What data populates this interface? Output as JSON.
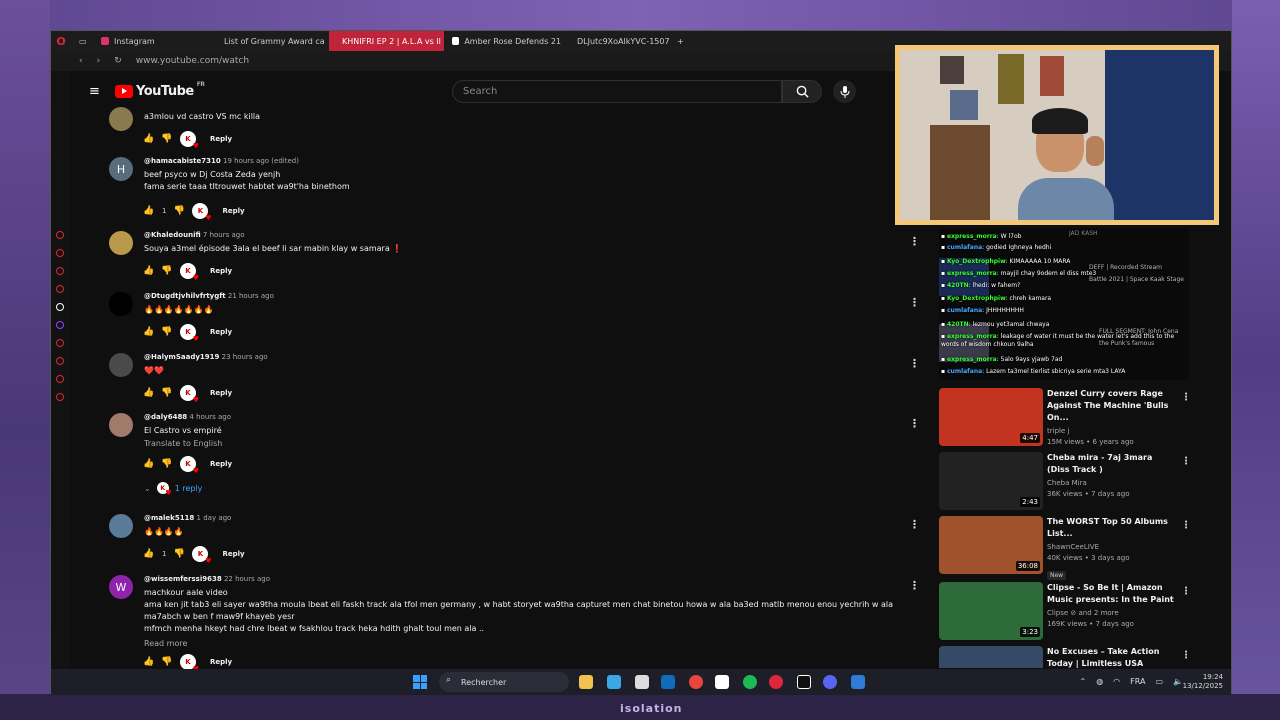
{
  "tabs": [
    {
      "label": "Instagram",
      "color": "#e1306c"
    },
    {
      "label": "List of Grammy Award ca",
      "color": "#ffffff"
    },
    {
      "label": "KHNIFRI EP 2 | A.L.A vs Il",
      "color": "#ff0000",
      "active": true
    },
    {
      "label": "Amber Rose Defends 21",
      "color": "#ffffff"
    },
    {
      "label": "DLJutc9XoAlkYVC-1507",
      "color": "#888888"
    }
  ],
  "new_tab_label": "+",
  "address": "www.youtube.com/watch",
  "youtube": {
    "logo_text": "YouTube",
    "region": "FR",
    "search_placeholder": "Search"
  },
  "comments": [
    {
      "author": "",
      "time": "",
      "text": "a3mlou vd castro VS mc killa",
      "likes": "",
      "reply_label": "Reply",
      "avatar_letter": "",
      "avatar_color": "#8a7a50"
    },
    {
      "author": "@hamacabiste7310",
      "time": "19 hours ago (edited)",
      "text": "beef psyco w Dj Costa Zeda yenjh",
      "text2": "fama serie taaa tItrouwet habtet wa9t'ha binethom",
      "likes": "1",
      "reply_label": "Reply",
      "avatar_letter": "H",
      "avatar_color": "#5a6b7a"
    },
    {
      "author": "@Khaledounifi",
      "time": "7 hours ago",
      "text": "Souya a3mel épisode 3ala el beef li sar mabin klay w samara ❗",
      "likes": "",
      "reply_label": "Reply",
      "avatar_letter": "",
      "avatar_color": "#b89a4a"
    },
    {
      "author": "@Dtugdtjvhilvfrtygft",
      "time": "21 hours ago",
      "text": "🔥🔥🔥🔥🔥🔥🔥",
      "likes": "",
      "reply_label": "Reply",
      "avatar_letter": "",
      "avatar_color": "#000000"
    },
    {
      "author": "@HalymSaady1919",
      "time": "23 hours ago",
      "text": "❤️❤️",
      "likes": "",
      "reply_label": "Reply",
      "avatar_letter": "",
      "avatar_color": "#4a4a4a"
    },
    {
      "author": "@daly6488",
      "time": "4 hours ago",
      "text": "El Castro vs empiré",
      "translate": "Translate to English",
      "likes": "",
      "reply_label": "Reply",
      "replies": "1 reply",
      "avatar_letter": "",
      "avatar_color": "#a07a6a"
    },
    {
      "author": "@malek5118",
      "time": "1 day ago",
      "text": "🔥🔥🔥🔥",
      "likes": "1",
      "reply_label": "Reply",
      "avatar_letter": "",
      "avatar_color": "#5a7a9a"
    },
    {
      "author": "@wissemferssi9638",
      "time": "22 hours ago",
      "text": "machkour aale video",
      "text2": "ama ken jit tab3 eli sayer wa9tha moula lbeat eli faskh track ala tfol men germany , w habt storyet wa9tha capturet men chat binetou howa w ala ba3ed matlb menou enou yechrih w ala ma7abch w ben f maw9f khayeb yesr",
      "text3": "mfmch menha hkeyt had chre lbeat  w fsakhlou track heka hdith ghalt toul men ala ..",
      "readmore": "Read more",
      "likes": "",
      "reply_label": "Reply",
      "avatar_letter": "W",
      "avatar_color": "#8e24aa"
    }
  ],
  "chat": [
    {
      "user": "express_morra",
      "text": ": W l7ob",
      "uc": "g"
    },
    {
      "user": "cumlafana",
      "text": ": godied Ighneya hedhi",
      "uc": "bl"
    },
    {
      "user": "Kyo_Dextrophpiw",
      "text": ": KIMAAAAA 10 MARA",
      "uc": "g"
    },
    {
      "user": "express_morra",
      "text": ": mayjil chay 9odem el diss mte3",
      "uc": "g"
    },
    {
      "user": "420TN",
      "text": ": lhedi: w fahem?",
      "uc": "g"
    },
    {
      "user": "Kyo_Dextrophpiw",
      "text": ": chreh kamara",
      "uc": "g"
    },
    {
      "user": "cumlafana",
      "text": ": JHHHHHHHH",
      "uc": "bl"
    },
    {
      "user": "420TN",
      "text": ": lezmou yet3amal chwaya",
      "uc": "g"
    },
    {
      "user": "express_morra",
      "text": ": leakage of water it must be the water let's add this to the words of wisdom chkoun 9alha",
      "uc": "g"
    },
    {
      "user": "express_morra",
      "text": ": 5alo 9ays yjawb 7ad",
      "uc": "g"
    },
    {
      "user": "cumlafana",
      "text": ": Lazem ta3mel tierlist sbicriya serie mta3 LAYA",
      "uc": "bl"
    }
  ],
  "chat_bg_titles": [
    "JAD KASH",
    "DEFF | Recorded Stream",
    "Battle 2021 | Space Kaak Stage",
    "FULL SEGMENT: John Cena",
    "the Punk's famous"
  ],
  "recommended": [
    {
      "title": "Denzel Curry covers Rage Against The Machine 'Bulls On...",
      "channel": "triple j",
      "stats": "15M views • 6 years ago",
      "duration": "4:47",
      "thumb_color": "#c2341f"
    },
    {
      "title": "Cheba mira - 7aj 3mara (Diss Track )",
      "channel": "Cheba Mira",
      "stats": "36K views • 7 days ago",
      "duration": "2:43",
      "thumb_color": "#222222"
    },
    {
      "title": "The WORST Top 50 Albums List...",
      "channel": "ShawnCeeLIVE",
      "stats": "40K views • 3 days ago",
      "badge": "New",
      "duration": "36:08",
      "thumb_color": "#a0522d"
    },
    {
      "title": "Clipse - So Be It | Amazon Music presents: In the Paint",
      "channel": "Clipse ⊘ and 2 more",
      "stats": "169K views • 7 days ago",
      "duration": "3:23",
      "thumb_color": "#2e6b3a"
    },
    {
      "title": "No Excuses – Take Action Today | Limitless USA",
      "channel": "",
      "stats": "",
      "duration": "",
      "thumb_color": "#354a66"
    }
  ],
  "taskbar": {
    "search_label": "Rechercher",
    "lang": "FRA",
    "time": "19:24",
    "date": "13/12/2025"
  },
  "bottom_logo": "isolation"
}
